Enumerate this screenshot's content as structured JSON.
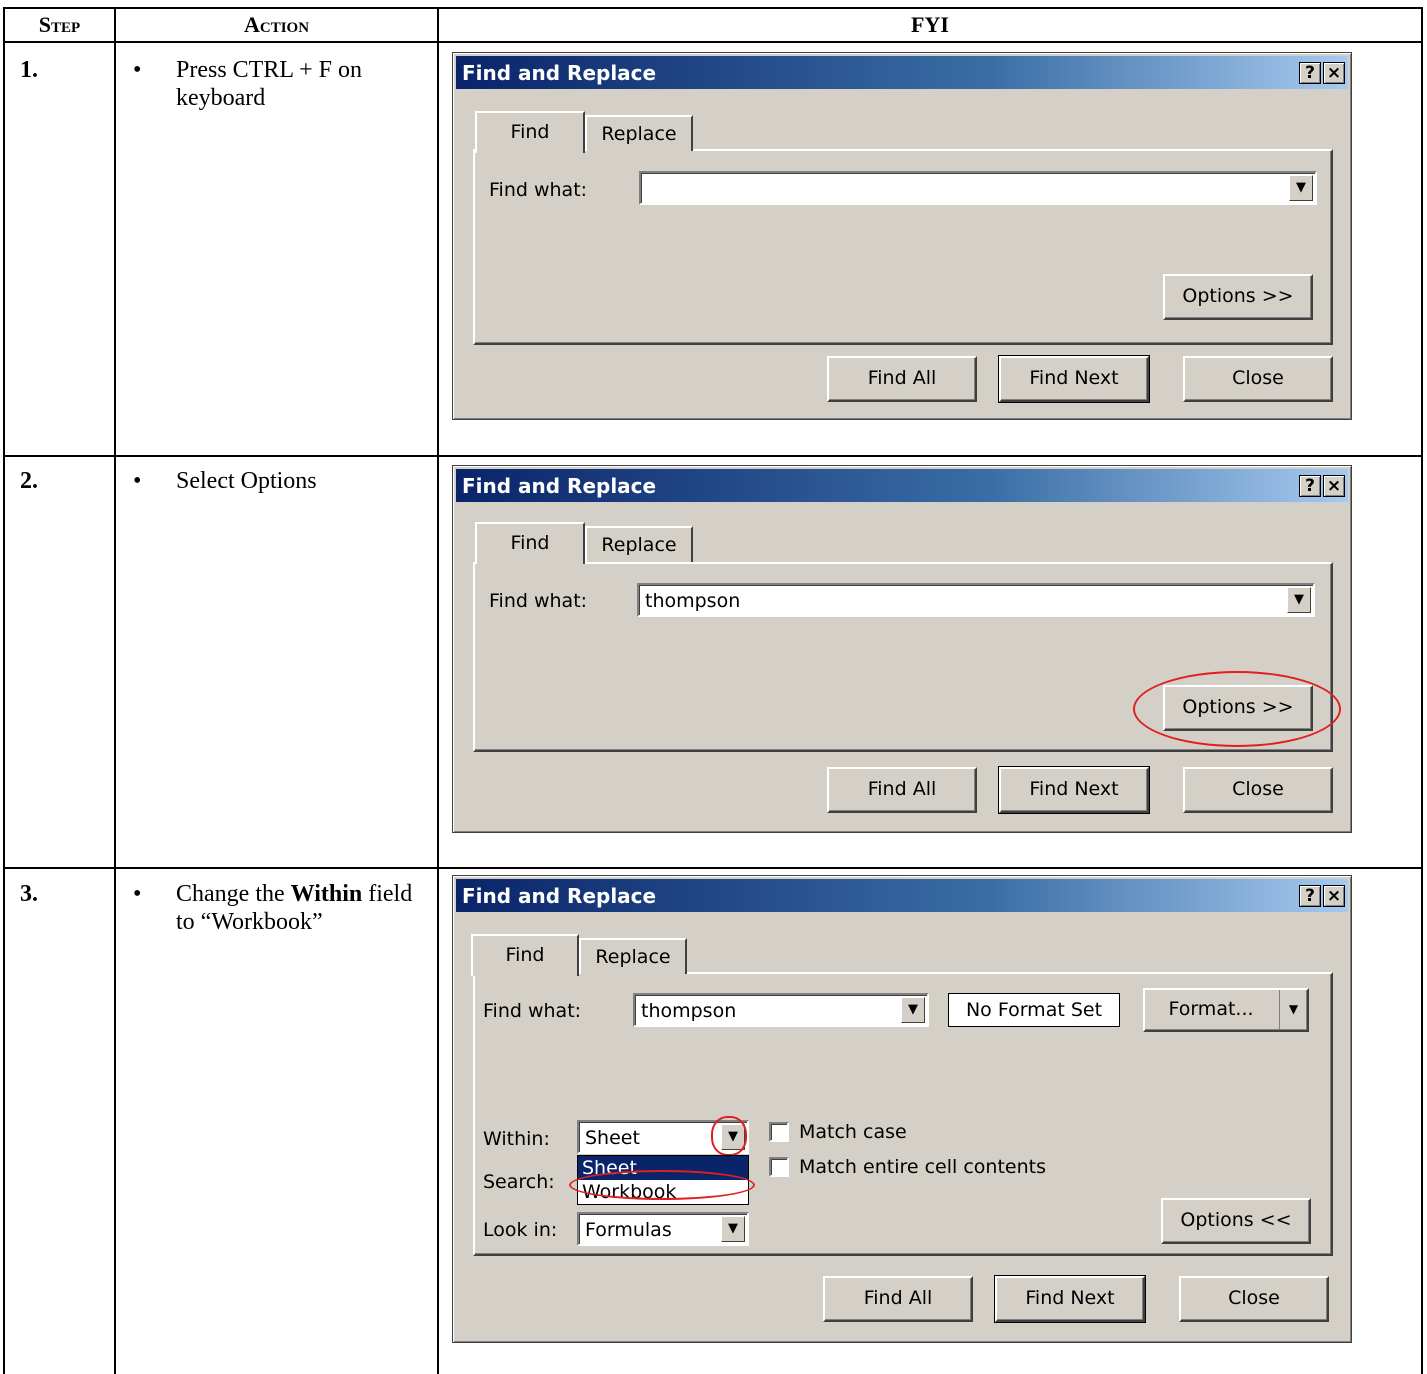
{
  "table": {
    "headers": {
      "step": "Step",
      "action": "Action",
      "fyi": "FYI"
    },
    "rows": [
      {
        "step": "1.",
        "bullet": "•",
        "action": "Press CTRL + F on keyboard"
      },
      {
        "step": "2.",
        "bullet": "•",
        "action": "Select Options"
      },
      {
        "step": "3.",
        "bullet": "•",
        "action_pre": "Change the ",
        "action_bold": "Within",
        "action_post": " field to “Workbook”"
      }
    ]
  },
  "dialog": {
    "title": "Find and Replace",
    "help_btn": "?",
    "close_btn": "×",
    "tab_find": "Find",
    "tab_replace": "Replace",
    "find_what_label": "Find what:",
    "arrow": "▼",
    "options_expand": "Options >>",
    "options_collapse": "Options <<",
    "find_all": "Find All",
    "find_next": "Find Next",
    "close": "Close"
  },
  "dialog1": {
    "find_value": ""
  },
  "dialog2": {
    "find_value": "thompson"
  },
  "dialog3": {
    "find_value": "thompson",
    "no_format": "No Format Set",
    "format_btn": "Format...",
    "within_label": "Within:",
    "within_value": "Sheet",
    "within_options": [
      "Sheet",
      "Workbook"
    ],
    "search_label": "Search:",
    "lookin_label": "Look in:",
    "lookin_value": "Formulas",
    "match_case": "Match case",
    "match_entire": "Match entire cell contents"
  },
  "colors": {
    "title_bar": "#0a246a",
    "dialog_bg": "#d4d0c8",
    "annotation": "#e02020"
  }
}
